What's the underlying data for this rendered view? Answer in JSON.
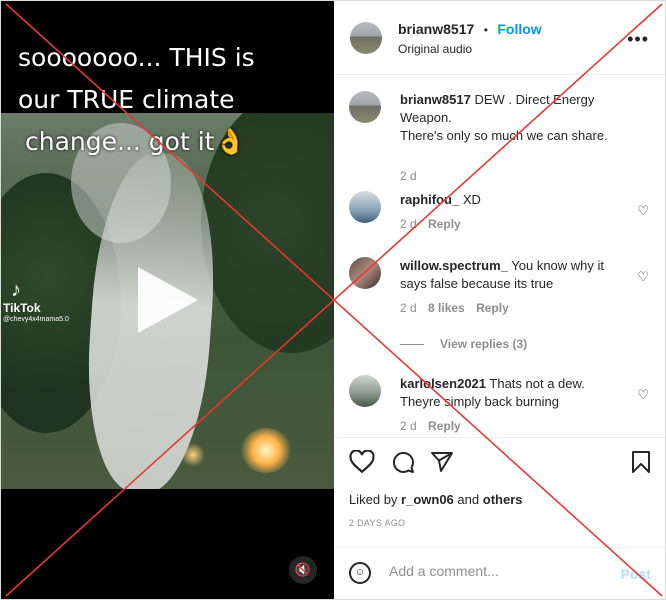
{
  "video": {
    "caption_lines": [
      "sooooooo... THIS is",
      "our TRUE climate",
      "change... got it👌"
    ],
    "watermark_brand": "TikTok",
    "watermark_handle": "@chevy4x4mama5.0"
  },
  "header": {
    "username": "brianw8517",
    "separator": "•",
    "follow_label": "Follow",
    "audio": "Original audio",
    "more_icon": "more-options-icon"
  },
  "comments": [
    {
      "user": "brianw8517",
      "text": "DEW . Direct Energy Weapon.",
      "text2": "There's only so much we can share.",
      "time": "2 d"
    },
    {
      "user": "raphifou_",
      "text": "XD",
      "time": "2 d",
      "reply": "Reply"
    },
    {
      "user": "willow.spectrum_",
      "text": "You know why it says false because its true",
      "time": "2 d",
      "likes": "8 likes",
      "reply": "Reply"
    },
    {
      "user": "karlolsen2021",
      "text": "Thats not a dew. Theyre simply back burning",
      "time": "2 d",
      "reply": "Reply"
    }
  ],
  "view_replies": "View replies (3)",
  "liked_by": {
    "prefix": "Liked by",
    "user": "r_own06",
    "and": "and",
    "others": "others"
  },
  "posted_ago": "2 DAYS AGO",
  "add_comment": {
    "placeholder": "Add a comment...",
    "post_label": "Post"
  },
  "colors": {
    "accent": "#0095f6",
    "cross": "#e53935"
  }
}
